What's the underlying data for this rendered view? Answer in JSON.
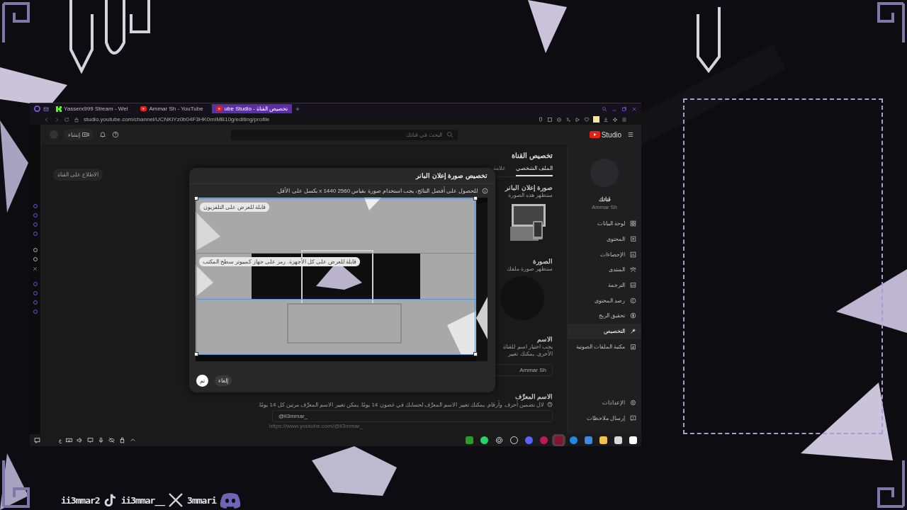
{
  "browser": {
    "tabs": [
      {
        "label": "ube Studio - تخصيص القناة",
        "selected": true,
        "kind": "youtube"
      },
      {
        "label": "Ammar Sh - YouTube",
        "selected": false,
        "kind": "youtube"
      },
      {
        "label": "Yasserx999 Stream - Wel",
        "selected": false,
        "kind": "kick"
      }
    ],
    "address": "studio.youtube.com/channel/UCNKlYz0b04F3HK0mIMB10g/editing/profile"
  },
  "studio": {
    "logo": "Studio",
    "search": {
      "placeholder": "البحث في قناتك"
    },
    "create_button": "إنشاء",
    "view_channel_button": "الاطلاع على القناة",
    "page_title": "تخصيص القناة",
    "tabs": [
      {
        "label": "الملف الشخصي",
        "selected": true
      },
      {
        "label": "علامة",
        "selected": false
      }
    ],
    "banner_section": {
      "title": "صورة إعلان البانر",
      "description": "ستظهر هذه الصورة"
    },
    "picture_section": {
      "title": "الصورة",
      "description": "ستظهر صورة ملفك"
    },
    "name_section": {
      "title": "الاسم",
      "description_lines": [
        "يجب اختيار اسم للقناة",
        "الأخرى. يمكنك تغيير"
      ],
      "value": "Ammar Sh"
    },
    "handle_section": {
      "title": "الاسم المعرِّف",
      "description": "لال تضمين أحرف وأرقام. يمكنك تغيير الاسم المعرِّف لحسابك في غضون 14 يومًا. يمكن تغيير الاسم المعرِّف مرتين كل 14 يومًا.",
      "value": "@ii3mmar_",
      "url": "https://www.youtube.com/@ii3mmar_"
    }
  },
  "sidebar": {
    "channel_label": "قناتك",
    "channel_name": "Ammar Sh",
    "items": [
      {
        "label": "لوحة البيانات",
        "kind": "dashboard",
        "selected": false
      },
      {
        "label": "المحتوى",
        "kind": "content",
        "selected": false
      },
      {
        "label": "الإحصاءات",
        "kind": "analytics",
        "selected": false
      },
      {
        "label": "المنتدى",
        "kind": "community",
        "selected": false
      },
      {
        "label": "الترجمة",
        "kind": "subtitles",
        "selected": false
      },
      {
        "label": "رصد المحتوى",
        "kind": "copyright",
        "selected": false
      },
      {
        "label": "تحقيق الربح",
        "kind": "money",
        "selected": false
      },
      {
        "label": "التخصيص",
        "kind": "customize",
        "selected": true
      },
      {
        "label": "مكتبة الملفات الصوتية",
        "kind": "audio",
        "selected": false
      }
    ],
    "bottom_items": [
      {
        "label": "الإعدادات",
        "kind": "settings"
      },
      {
        "label": "إرسال ملاحظات",
        "kind": "feedback"
      }
    ]
  },
  "dialog": {
    "title": "تخصيص صورة إعلان البانر",
    "info": "للحصول على أفضل النتائج، يجب استخدام صورة بقياس 2560 x 1440 بكسل على الأقل.",
    "tv_label": "قابلة للعرض على التلفزيون",
    "all_devices_label": "قابلة للعرض على كل الأجهزة. رمز على جهاز كمبيوتر سطح المكتب",
    "done_button": "تم",
    "cancel_button": "إلغاء"
  },
  "taskbar": {
    "language": "ع"
  },
  "socials": [
    {
      "handle": "3mmari",
      "kind": "discord"
    },
    {
      "handle": "ii3mmar__",
      "kind": "x"
    },
    {
      "handle": "ii3mmar2",
      "kind": "tiktok"
    }
  ]
}
